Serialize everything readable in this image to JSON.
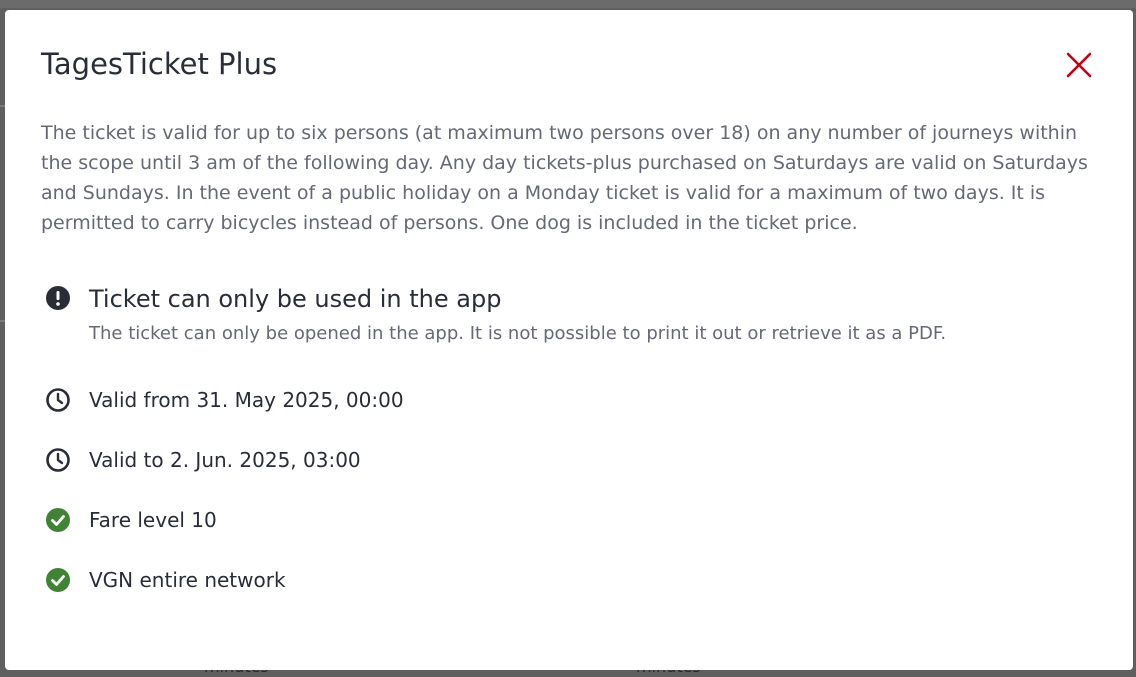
{
  "dialog": {
    "title": "TagesTicket Plus",
    "close_icon": "close-icon",
    "accent_color": "#c50014",
    "description": "The ticket is valid for up to six persons (at maximum two persons over 18) on any number of journeys within the scope until 3 am of the following day. Any day tickets-plus purchased on Saturdays are valid on Saturdays and Sundays. In the event of a public holiday on a Monday ticket is valid for a maximum of two days. It is permitted to carry bicycles instead of persons. One dog is included in the ticket price."
  },
  "features": [
    {
      "icon": "alert-icon",
      "title": "Ticket can only be used in the app",
      "subtitle": "The ticket can only be opened in the app. It is not possible to print it out or retrieve it as a PDF."
    },
    {
      "icon": "clock-icon",
      "title": "Valid from 31. May 2025, 00:00"
    },
    {
      "icon": "clock-icon",
      "title": "Valid to 2. Jun. 2025, 03:00"
    },
    {
      "icon": "check-circle-icon",
      "title": "Fare level 10",
      "color": "#408335"
    },
    {
      "icon": "check-circle-icon",
      "title": "VGN entire network",
      "color": "#408335"
    }
  ],
  "background": {
    "fragment_left": "minutes",
    "fragment_right": "minutes"
  }
}
